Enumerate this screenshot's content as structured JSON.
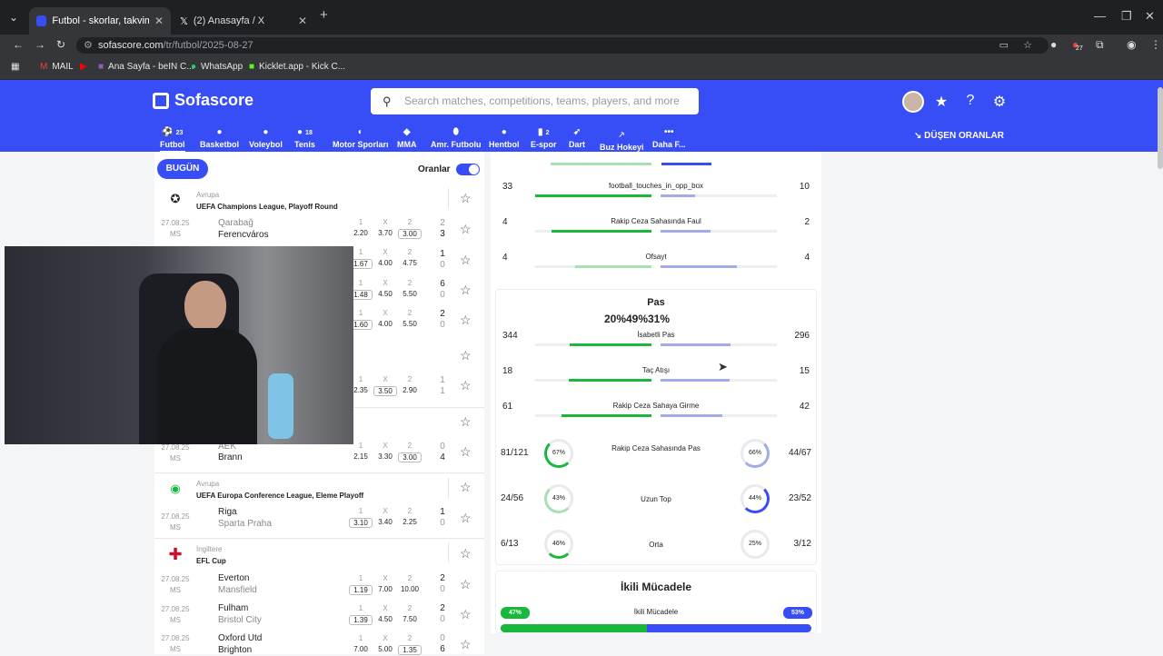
{
  "browser": {
    "tabs": [
      {
        "title": "Futbol - skorlar, takvim & oranl",
        "active": true
      },
      {
        "title": "(2) Anasayfa / X",
        "active": false
      }
    ],
    "url_host": "sofascore.com",
    "url_path": "/tr/futbol/2025-08-27",
    "bookmarks": [
      "MAIL",
      "Ana Sayfa - beIN C...",
      "WhatsApp",
      "Kicklet.app - Kick C..."
    ],
    "extension_badge": "27"
  },
  "header": {
    "brand": "Sofascore",
    "search_placeholder": "Search matches, competitions, teams, players, and more",
    "accent_color": "#374df5",
    "sports": [
      {
        "label": "Futbol",
        "count": "23",
        "icon": "football-icon"
      },
      {
        "label": "Basketbol",
        "count": "",
        "icon": "basketball-icon"
      },
      {
        "label": "Voleybol",
        "count": "",
        "icon": "volleyball-icon"
      },
      {
        "label": "Tenis",
        "count": "18",
        "icon": "tennis-icon"
      },
      {
        "label": "Motor Sporları",
        "count": "",
        "icon": "motorsport-icon"
      },
      {
        "label": "MMA",
        "count": "",
        "icon": "mma-icon"
      },
      {
        "label": "Amr. Futbolu",
        "count": "",
        "icon": "american-football-icon"
      },
      {
        "label": "Hentbol",
        "count": "",
        "icon": "handball-icon"
      },
      {
        "label": "E-spor",
        "count": "2",
        "icon": "esports-icon"
      },
      {
        "label": "Dart",
        "count": "",
        "icon": "darts-icon"
      },
      {
        "label": "Buz Hokeyi",
        "count": "",
        "icon": "ice-hockey-icon"
      },
      {
        "label": "Daha F...",
        "count": "",
        "icon": "more-icon"
      }
    ],
    "dropping_odds": "DÜŞEN ORANLAR"
  },
  "left": {
    "today": "BUGÜN",
    "odds_label": "Oranlar",
    "odds_headers": [
      "1",
      "X",
      "2"
    ],
    "leagues": [
      {
        "country": "Avrupa",
        "name": "UEFA Champions League, Playoff Round"
      },
      {
        "country": "Avrupa",
        "name": "UEFA Europa Conference League, Eleme Playoff"
      },
      {
        "country": "İngiltere",
        "name": "EFL Cup"
      }
    ],
    "matches": [
      {
        "date": "27.08.25",
        "status": "MS",
        "home": "Qarabağ",
        "away": "Ferencváros",
        "o1": "2.20",
        "ox": "3.70",
        "o2": "3.00",
        "sh": "2",
        "sa": "3"
      },
      {
        "date": "",
        "status": "",
        "home": "",
        "away": "",
        "o1": "1.67",
        "ox": "4.00",
        "o2": "4.75",
        "sh": "1",
        "sa": "0"
      },
      {
        "date": "",
        "status": "",
        "home": "",
        "away": "",
        "o1": "1.48",
        "ox": "4.50",
        "o2": "5.50",
        "sh": "6",
        "sa": "0"
      },
      {
        "date": "",
        "status": "",
        "home": "",
        "away": "",
        "o1": "1.60",
        "ox": "4.00",
        "o2": "5.50",
        "sh": "2",
        "sa": "0"
      },
      {
        "date": "",
        "status": "",
        "home": "",
        "away": "",
        "o1": "2.35",
        "ox": "3.50",
        "o2": "2.90",
        "sh": "1",
        "sa": "1"
      },
      {
        "date": "27.08.25",
        "status": "MS",
        "home": "AEK",
        "away": "Brann",
        "o1": "2.15",
        "ox": "3.30",
        "o2": "3.00",
        "sh": "0",
        "sa": "4"
      },
      {
        "date": "27.08.25",
        "status": "MS",
        "home": "Riga",
        "away": "Sparta Praha",
        "o1": "3.10",
        "ox": "3.40",
        "o2": "2.25",
        "sh": "1",
        "sa": "0"
      },
      {
        "date": "27.08.25",
        "status": "MS",
        "home": "Everton",
        "away": "Mansfield",
        "o1": "1.19",
        "ox": "7.00",
        "o2": "10.00",
        "sh": "2",
        "sa": "0"
      },
      {
        "date": "27.08.25",
        "status": "MS",
        "home": "Fulham",
        "away": "Bristol City",
        "o1": "1.39",
        "ox": "4.50",
        "o2": "7.50",
        "sh": "2",
        "sa": "0"
      },
      {
        "date": "27.08.25",
        "status": "MS",
        "home": "Oxford Utd",
        "away": "Brighton",
        "o1": "7.00",
        "ox": "5.00",
        "o2": "1.35",
        "sh": "0",
        "sa": "6"
      }
    ]
  },
  "stats": {
    "top_rows": [
      {
        "name": "football_touches_in_opp_box",
        "home": "33",
        "away": "10",
        "home_pct": 100,
        "away_pct": 30
      },
      {
        "name": "Rakip Ceza Sahasında Faul",
        "home": "4",
        "away": "2",
        "home_pct": 86,
        "away_pct": 43
      },
      {
        "name": "Ofsayt",
        "home": "4",
        "away": "4",
        "home_pct": 66,
        "away_pct": 66
      }
    ],
    "pass_section": {
      "title": "Pas",
      "summary": "20%49%31%",
      "rows": [
        {
          "name": "İsabetli Pas",
          "home": "344",
          "away": "296",
          "home_pct": 70,
          "away_pct": 60
        },
        {
          "name": "Taç Atışı",
          "home": "18",
          "away": "15",
          "home_pct": 71,
          "away_pct": 59
        },
        {
          "name": "Rakip Ceza Sahaya Girme",
          "home": "61",
          "away": "42",
          "home_pct": 77,
          "away_pct": 53
        }
      ],
      "ratio_rows": [
        {
          "name": "Rakip Ceza Sahasında Pas",
          "home": "81/121",
          "away": "44/67",
          "home_pct": "67%",
          "away_pct": "66%"
        },
        {
          "name": "Uzun Top",
          "home": "24/56",
          "away": "23/52",
          "home_pct": "43%",
          "away_pct": "44%"
        },
        {
          "name": "Orta",
          "home": "6/13",
          "away": "3/12",
          "home_pct": "46%",
          "away_pct": "25%"
        }
      ]
    },
    "duel_section": {
      "title": "İkili Mücadele",
      "row_name": "İkili Mücadele",
      "home_pct": "47%",
      "away_pct": "53%",
      "home_share": 0.47
    },
    "home_color": "#19b83d",
    "away_color": "#374df5"
  }
}
